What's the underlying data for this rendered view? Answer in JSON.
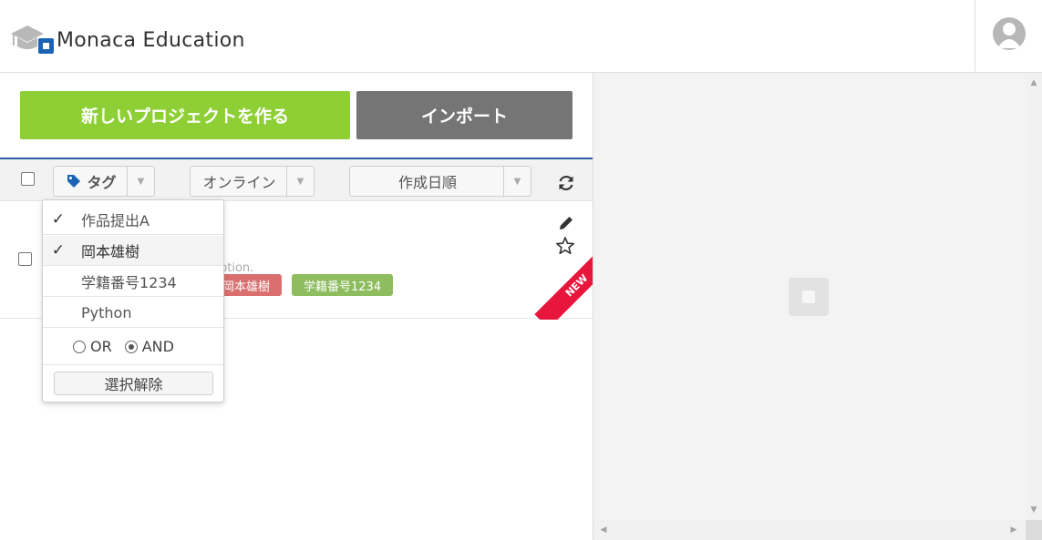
{
  "header": {
    "logo_text": "Monaca Education",
    "avatar_icon": "user-avatar-icon"
  },
  "actions": {
    "new_project_label": "新しいプロジェクトを作る",
    "import_label": "インポート"
  },
  "toolbar": {
    "tag_filter_label": "タグ",
    "location_filter_label": "オンライン",
    "sort_label": "作成日順",
    "refresh_icon": "refresh-icon",
    "accent_color": "#2d5fa6"
  },
  "project": {
    "description_fragment": "ption.",
    "tags": [
      {
        "label": "岡本雄樹",
        "color": "#d9706f"
      },
      {
        "label": "学籍番号1234",
        "color": "#8ebd5f"
      }
    ],
    "new_badge": "NEW",
    "new_badge_color": "#e8153d"
  },
  "tag_menu": {
    "items": [
      {
        "label": "作品提出A",
        "checked": true,
        "check_mark": "✓"
      },
      {
        "label": "岡本雄樹",
        "checked": true,
        "check_mark": "✓"
      },
      {
        "label": "学籍番号1234",
        "checked": false,
        "check_mark": ""
      },
      {
        "label": "Python",
        "checked": false,
        "check_mark": ""
      }
    ],
    "mode_or_label": "OR",
    "mode_and_label": "AND",
    "selected_mode": "AND",
    "clear_label": "選択解除"
  },
  "colors": {
    "new_button": "#8ecf36",
    "import_button": "#757575"
  }
}
